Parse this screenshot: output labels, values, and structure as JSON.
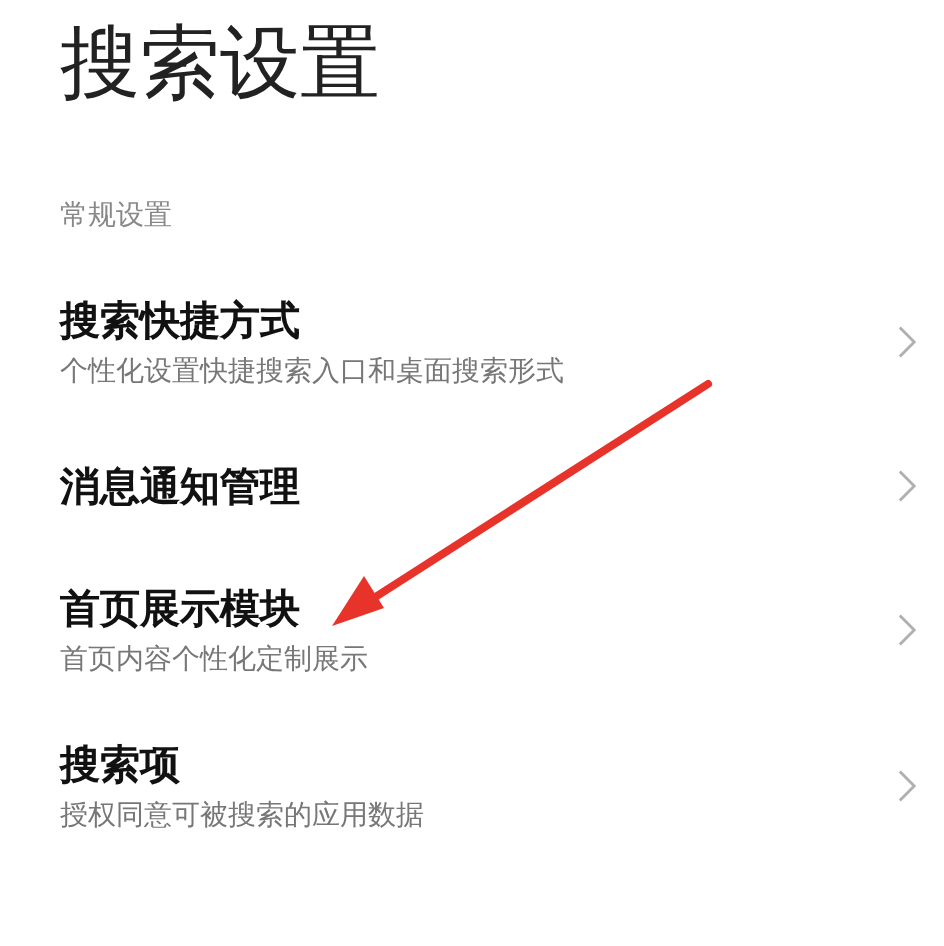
{
  "page_title": "搜索设置",
  "section": {
    "label": "常规设置"
  },
  "items": [
    {
      "title": "搜索快捷方式",
      "subtitle": "个性化设置快捷搜索入口和桌面搜索形式"
    },
    {
      "title": "消息通知管理"
    },
    {
      "title": "首页展示模块",
      "subtitle": "首页内容个性化定制展示"
    },
    {
      "title": "搜索项",
      "subtitle": "授权同意可被搜索的应用数据"
    }
  ]
}
